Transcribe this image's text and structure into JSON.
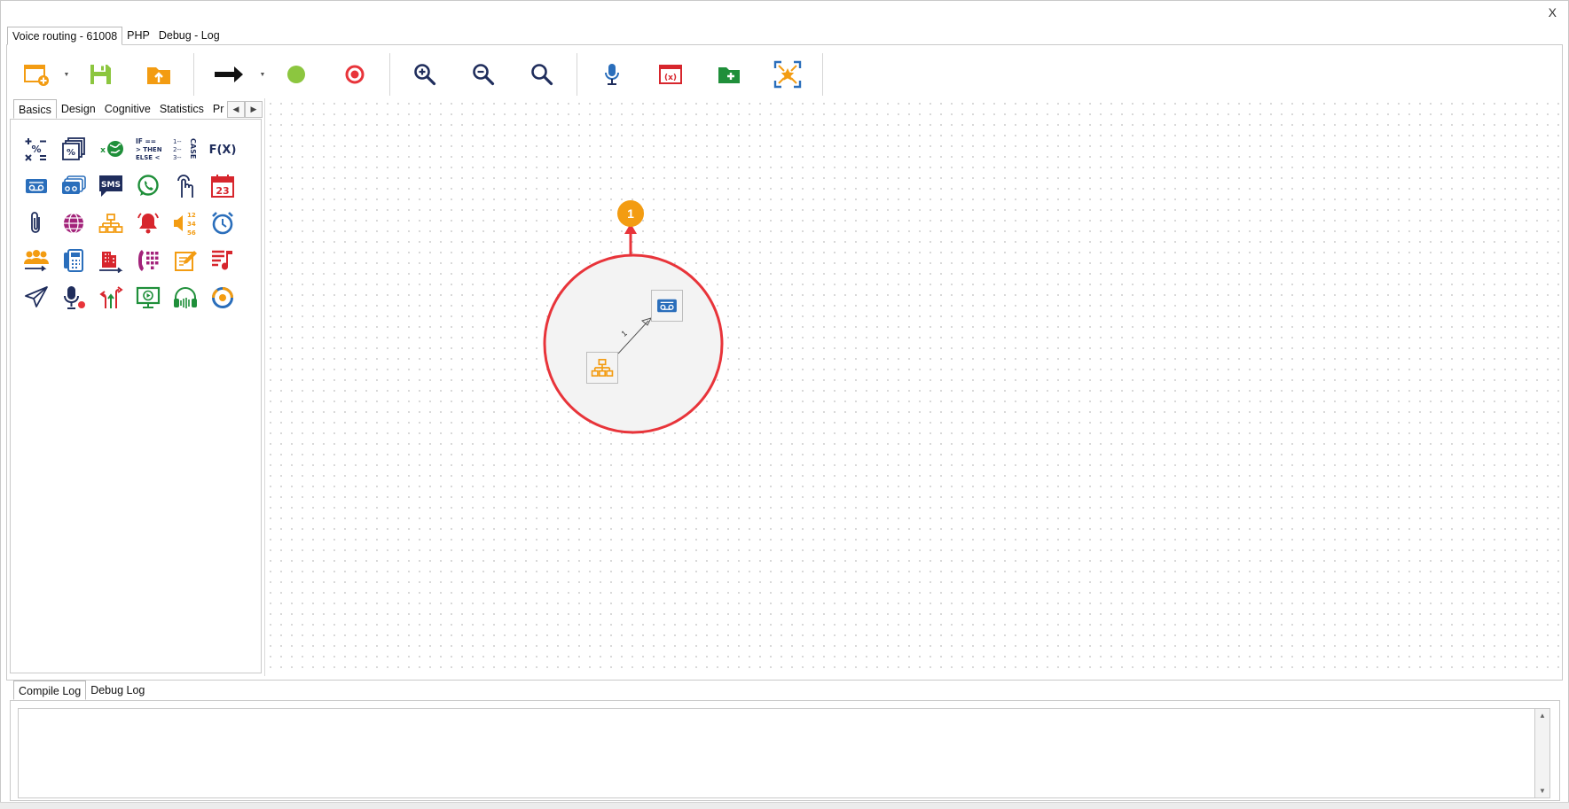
{
  "window": {
    "close_label": "X"
  },
  "top_tabs": [
    {
      "label": "Voice routing - 61008",
      "active": true
    },
    {
      "label": "PHP",
      "active": false
    },
    {
      "label": "Debug - Log",
      "active": false
    }
  ],
  "toolbar": {
    "buttons": [
      {
        "name": "new-window-icon",
        "group": 1,
        "dropdown": true
      },
      {
        "name": "save-icon",
        "group": 1
      },
      {
        "name": "upload-folder-icon",
        "group": 1
      },
      {
        "name": "arrow-right-icon",
        "group": 2,
        "dropdown": true
      },
      {
        "name": "green-dot-icon",
        "group": 2
      },
      {
        "name": "record-target-icon",
        "group": 2
      },
      {
        "name": "zoom-in-icon",
        "group": 3
      },
      {
        "name": "zoom-out-icon",
        "group": 3
      },
      {
        "name": "search-icon",
        "group": 3
      },
      {
        "name": "microphone-icon",
        "group": 4
      },
      {
        "name": "variable-window-icon",
        "group": 4
      },
      {
        "name": "folder-add-icon",
        "group": 4
      },
      {
        "name": "fit-screen-icon",
        "group": 4
      }
    ]
  },
  "palette": {
    "tabs": [
      {
        "label": "Basics",
        "active": true
      },
      {
        "label": "Design",
        "active": false
      },
      {
        "label": "Cognitive",
        "active": false
      },
      {
        "label": "Statistics",
        "active": false
      },
      {
        "label": "Pr",
        "active": false
      }
    ],
    "arrow_left": "◀",
    "arrow_right": "▶",
    "icons": [
      "math-operators-icon",
      "percent-stack-icon",
      "global-variable-icon",
      "if-then-else-icon",
      "case-icon",
      "function-icon",
      "voicemail-icon",
      "voicemail-stack-icon",
      "sms-icon",
      "whatsapp-icon",
      "touch-press-icon",
      "calendar-icon",
      "attachment-icon",
      "globe-icon",
      "hierarchy-icon",
      "alarm-bell-icon",
      "speaker-numbers-icon",
      "alarm-clock-icon",
      "queue-users-icon",
      "phone-directory-icon",
      "building-icon",
      "dialpad-icon",
      "edit-note-icon",
      "music-playlist-icon",
      "send-paperplane-icon",
      "mic-record-icon",
      "split-arrows-icon",
      "screen-play-icon",
      "headset-icon",
      "progress-ring-icon"
    ],
    "text": {
      "function": "F(X)",
      "sms": "SMS",
      "calendar_day": "23",
      "if_lines": [
        "IF ==",
        "> THEN",
        "ELSE <"
      ],
      "case_label": "CASE",
      "speaker_numbers": [
        "12",
        "34",
        "56"
      ]
    }
  },
  "canvas": {
    "badge_number": "1",
    "connector_label": "1",
    "highlight_color": "#e8343a",
    "badge_color": "#f39c12",
    "nodes": [
      {
        "name": "hierarchy-node"
      },
      {
        "name": "voicemail-node"
      }
    ]
  },
  "bottom_tabs": [
    {
      "label": "Compile Log",
      "active": true
    },
    {
      "label": "Debug Log",
      "active": false
    }
  ],
  "scrollbar": {
    "up": "▲",
    "down": "▼"
  }
}
